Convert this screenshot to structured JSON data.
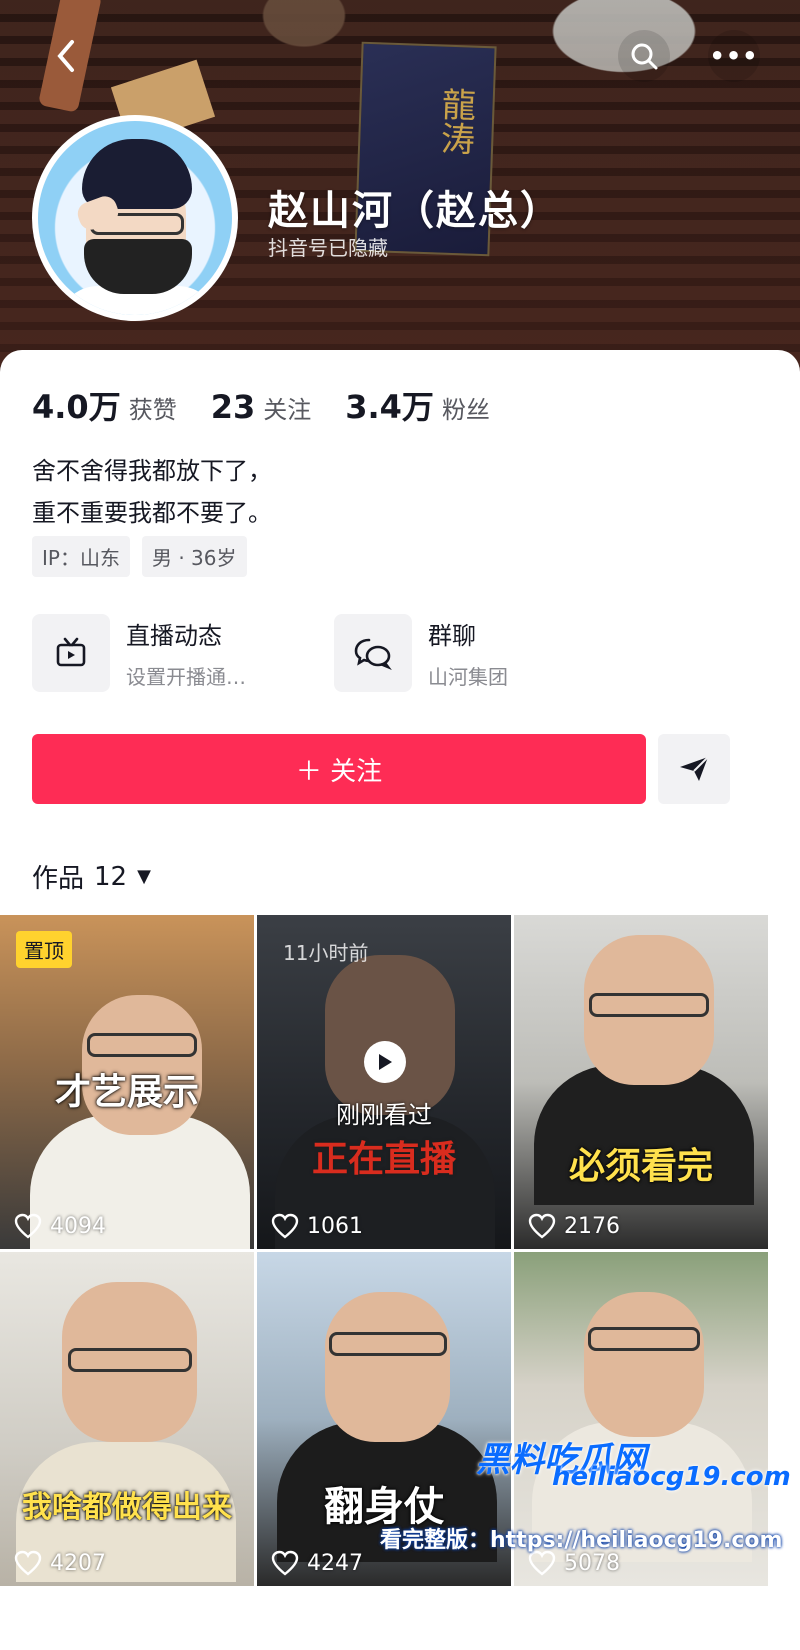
{
  "header": {
    "name": "赵山河（赵总）",
    "subname": "抖音号已隐藏"
  },
  "stats": [
    {
      "value": "4.0万",
      "label": "获赞"
    },
    {
      "value": "23",
      "label": "关注"
    },
    {
      "value": "3.4万",
      "label": "粉丝"
    }
  ],
  "bio": {
    "line1": "舍不舍得我都放下了，",
    "line2": "重不重要我都不要了。"
  },
  "tags": [
    "IP：山东",
    "男 · 36岁"
  ],
  "features": [
    {
      "title": "直播动态",
      "subtitle": "设置开播通…",
      "icon": "tv-icon"
    },
    {
      "title": "群聊",
      "subtitle": "山河集团",
      "icon": "chat-bubbles-icon"
    }
  ],
  "actions": {
    "follow_label": "＋ 关注"
  },
  "works": {
    "label": "作品",
    "count": "12"
  },
  "videos": [
    {
      "caption": "才艺展示",
      "likes": "4094",
      "pinned": "置顶"
    },
    {
      "caption": "正在直播",
      "likes": "1061",
      "time": "11小时前",
      "watched": "刚刚看过"
    },
    {
      "caption": "必须看完",
      "likes": "2176"
    },
    {
      "caption": "我啥都做得出来",
      "likes": "4207"
    },
    {
      "caption": "翻身仗",
      "likes": "4247"
    },
    {
      "caption": "",
      "likes": "5078"
    }
  ],
  "watermark": {
    "line1": "黑料吃瓜网",
    "line2": "heiliaocg19.com",
    "line3": "看完整版：https://heiliaocg19.com"
  },
  "colors": {
    "follow": "#fe2c55",
    "pinned": "#ffd22e"
  }
}
